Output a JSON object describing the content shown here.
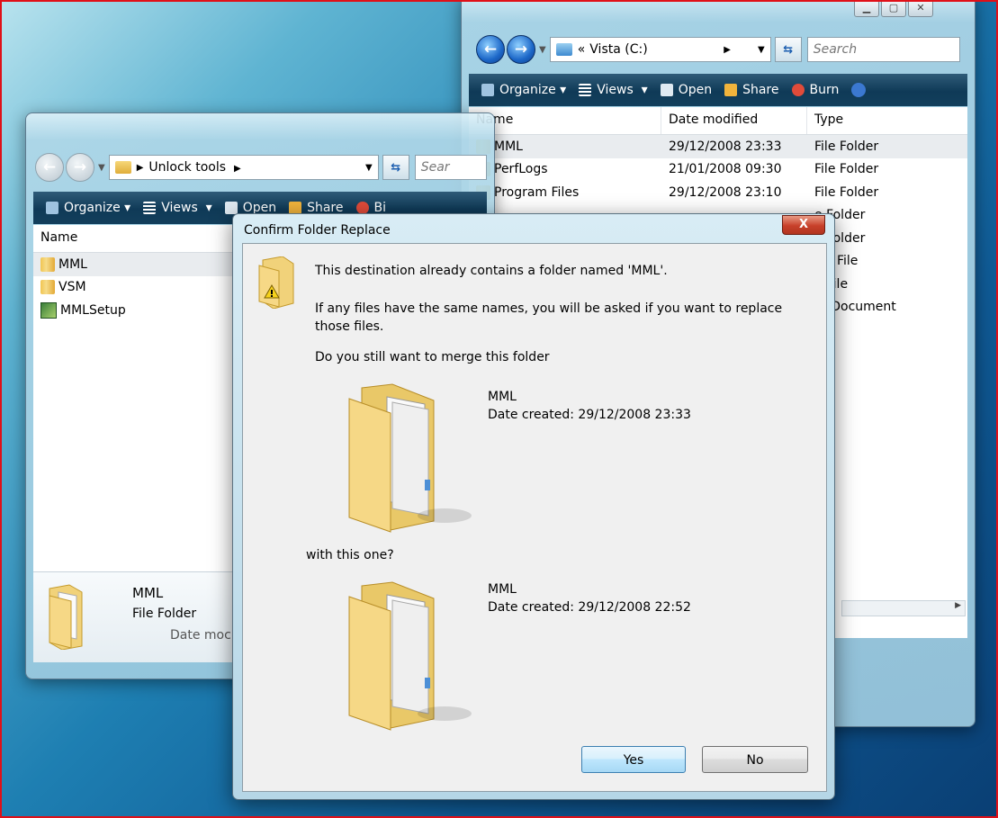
{
  "left_window": {
    "address": {
      "folder_label": "Unlock tools",
      "search_placeholder": "Sear"
    },
    "toolbar": {
      "organize": "Organize",
      "views": "Views",
      "open": "Open",
      "share": "Share",
      "burn": "Bi"
    },
    "columns": {
      "name": "Name"
    },
    "files": [
      {
        "name": "MML",
        "icon": "folder-icon",
        "selected": true
      },
      {
        "name": "VSM",
        "icon": "folder-icon",
        "selected": false
      },
      {
        "name": "MMLSetup",
        "icon": "setup-icon",
        "selected": false
      }
    ],
    "details": {
      "name": "MML",
      "type": "File Folder",
      "date_label": "Date moc"
    }
  },
  "right_window": {
    "address": {
      "crumb_prefix": "«",
      "location": "Vista (C:)",
      "search_placeholder": "Search"
    },
    "toolbar": {
      "organize": "Organize",
      "views": "Views",
      "open": "Open",
      "share": "Share",
      "burn": "Burn"
    },
    "columns": {
      "name": "Name",
      "date": "Date modified",
      "type": "Type"
    },
    "files": [
      {
        "name": "MML",
        "date": "29/12/2008 23:33",
        "type": "File Folder"
      },
      {
        "name": "PerfLogs",
        "date": "21/01/2008 09:30",
        "type": "File Folder"
      },
      {
        "name": "Program Files",
        "date": "29/12/2008 23:10",
        "type": "File Folder"
      }
    ],
    "partial_types": [
      "e Folder",
      "e Folder",
      "MP File",
      "K File",
      "xt Document"
    ]
  },
  "dialog": {
    "title": "Confirm Folder Replace",
    "close_label": "X",
    "message": "This destination already contains a folder named 'MML'.",
    "detail": "If any files have the same names, you will be asked if you want to replace those files.",
    "question": "Do you still want to merge this folder",
    "source": {
      "name": "MML",
      "date": "Date created: 29/12/2008 23:33"
    },
    "with_label": "with this one?",
    "target": {
      "name": "MML",
      "date": "Date created: 29/12/2008 22:52"
    },
    "buttons": {
      "yes": "Yes",
      "no": "No"
    }
  }
}
